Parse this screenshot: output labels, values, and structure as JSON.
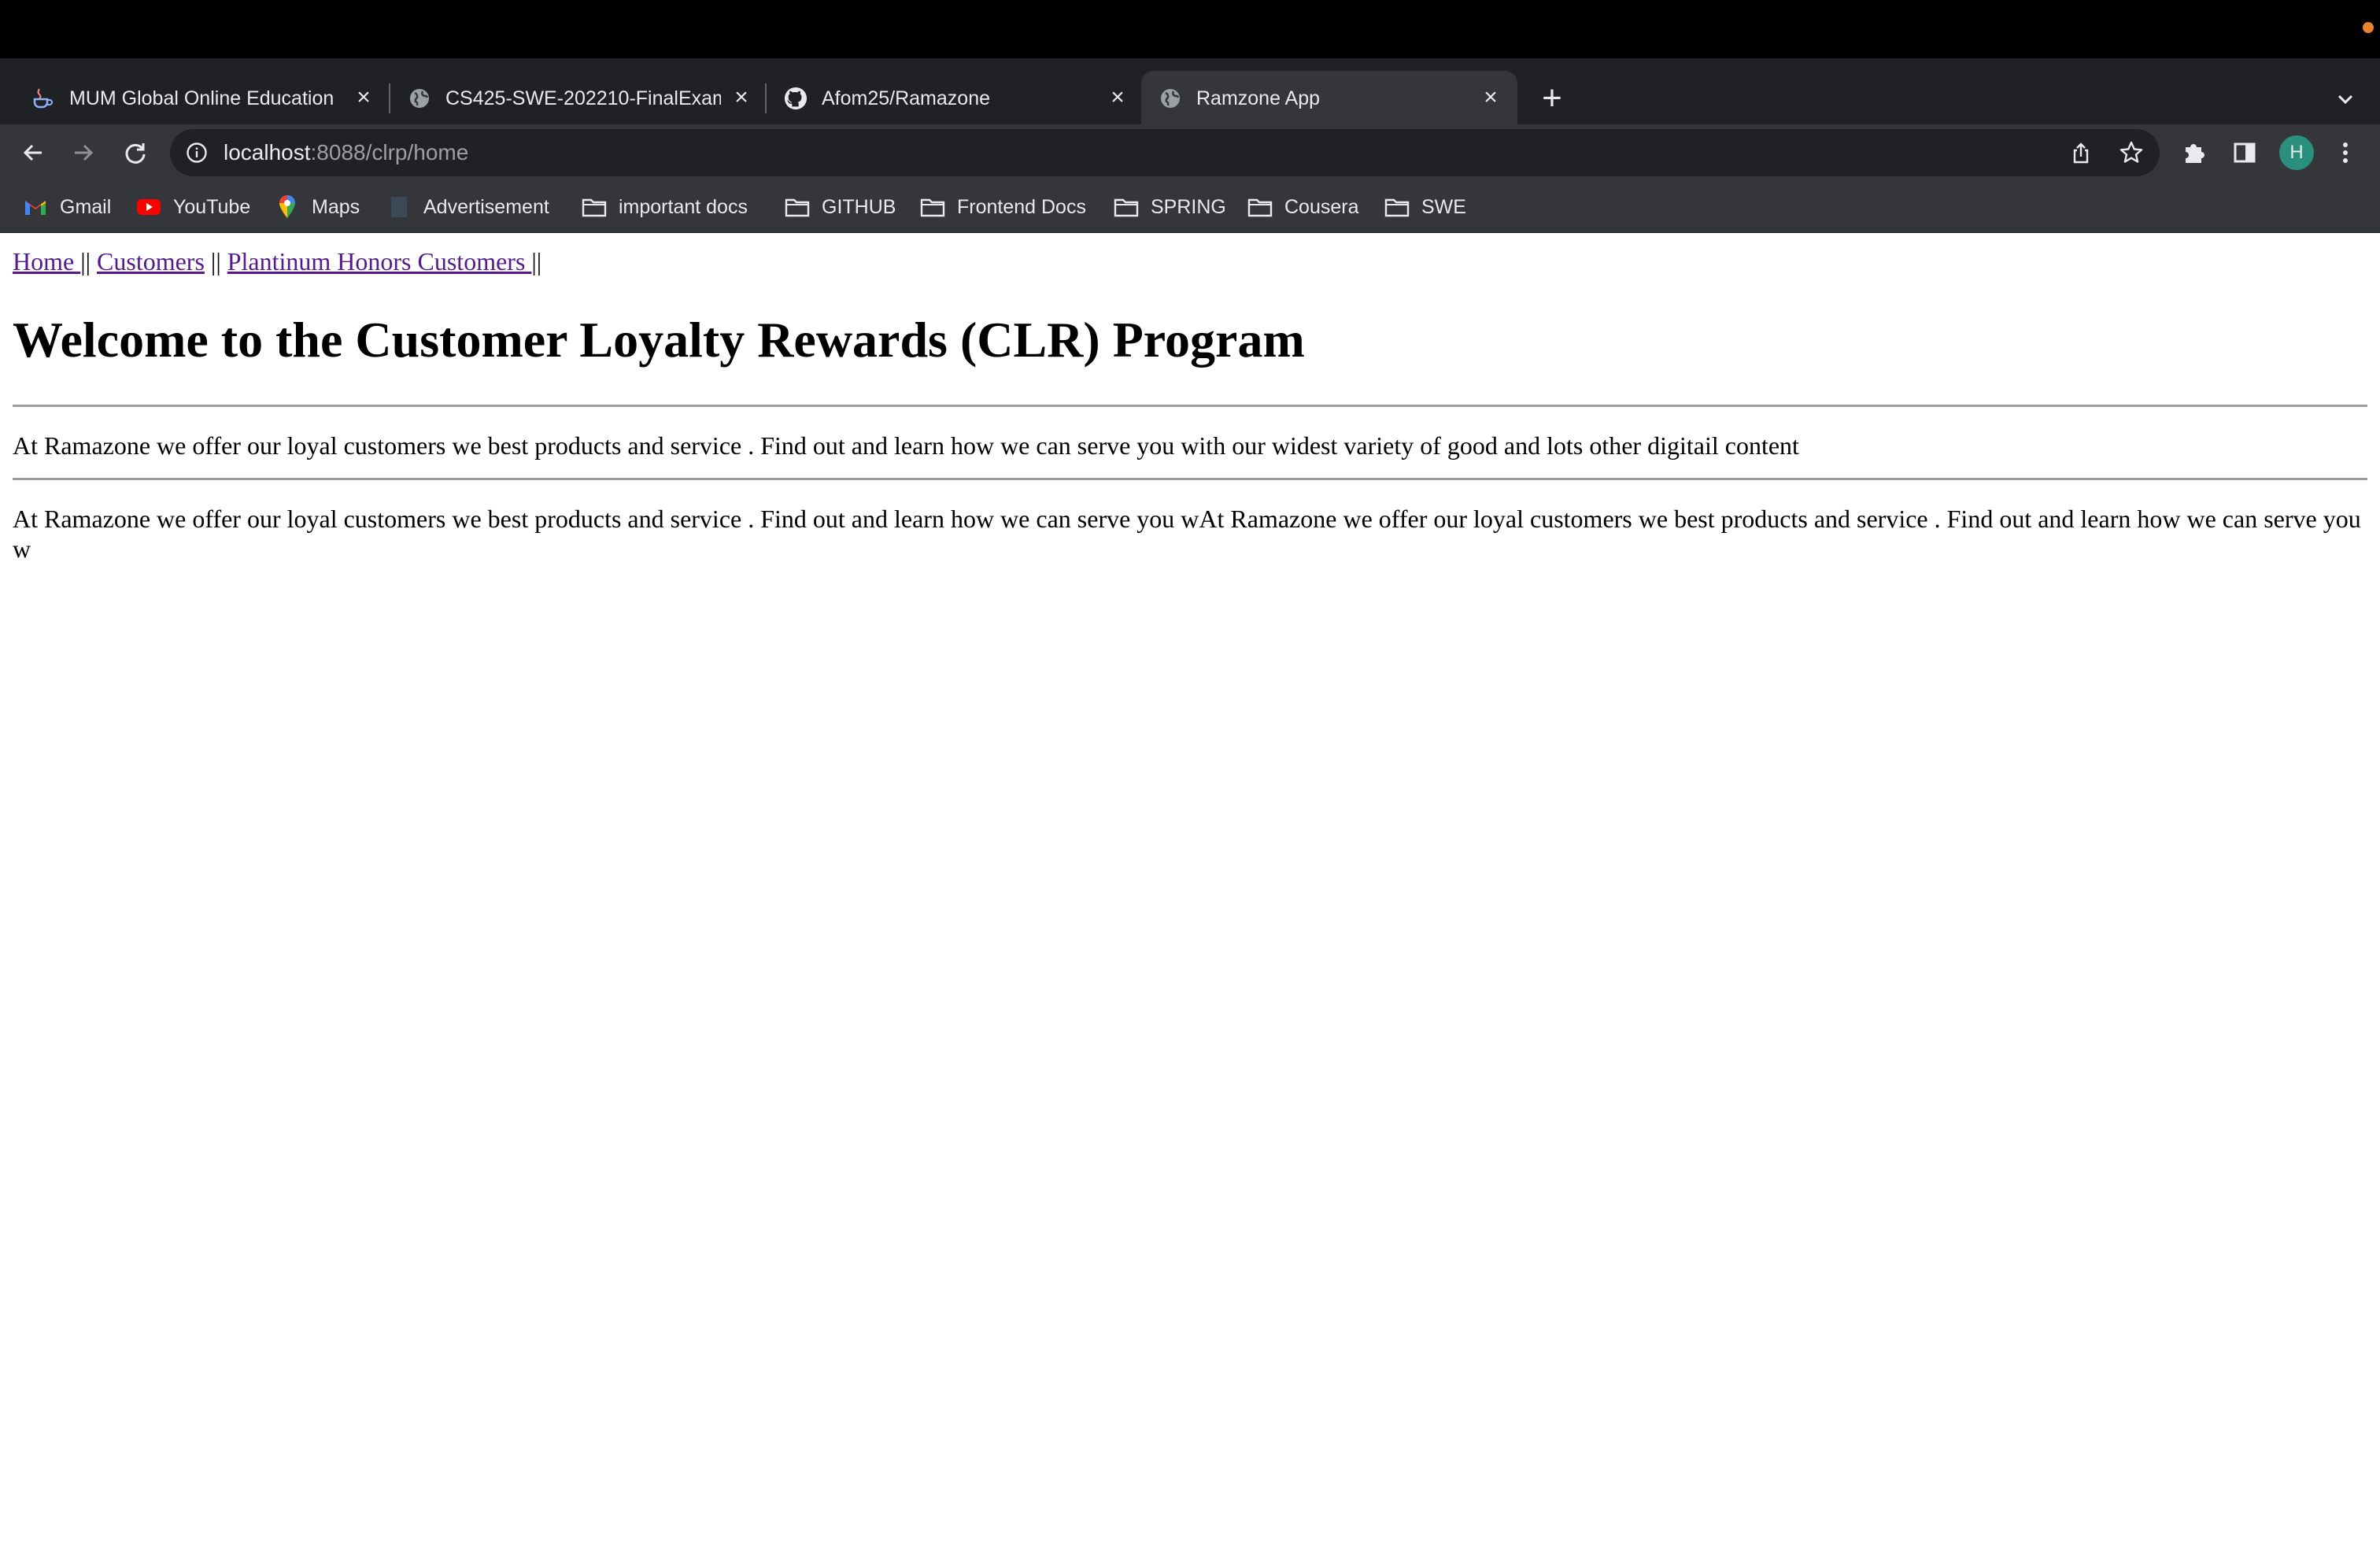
{
  "browser": {
    "tabs": [
      {
        "title": "MUM Global Online Education ·",
        "favicon": "java-cup-icon",
        "active": false
      },
      {
        "title": "CS425-SWE-202210-FinalExam",
        "favicon": "globe-icon",
        "active": false
      },
      {
        "title": "Afom25/Ramazone",
        "favicon": "github-icon",
        "active": false
      },
      {
        "title": "Ramzone App",
        "favicon": "globe-icon",
        "active": true
      }
    ],
    "address": {
      "host": "localhost",
      "path": ":8088/clrp/home"
    },
    "profile_initial": "H",
    "bookmarks": [
      {
        "label": "Gmail",
        "icon": "gmail-icon"
      },
      {
        "label": "YouTube",
        "icon": "youtube-icon"
      },
      {
        "label": "Maps",
        "icon": "maps-icon"
      },
      {
        "label": "Advertisement",
        "icon": "blank-page-icon"
      },
      {
        "label": "important docs",
        "icon": "folder-icon"
      },
      {
        "label": "GITHUB",
        "icon": "folder-icon"
      },
      {
        "label": "Frontend Docs",
        "icon": "folder-icon"
      },
      {
        "label": "SPRING",
        "icon": "folder-icon"
      },
      {
        "label": "Cousera",
        "icon": "folder-icon"
      },
      {
        "label": "SWE",
        "icon": "folder-icon"
      }
    ]
  },
  "page": {
    "nav": {
      "home": "Home ",
      "customers": "Customers",
      "platinum": "Plantinum Honors Customers ",
      "separator": "||"
    },
    "heading": "Welcome to the Customer Loyalty Rewards (CLR) Program",
    "paragraph1": "At Ramazone we offer our loyal customers we best products and service . Find out and learn how we can serve you with our widest variety of good and lots other digitail content",
    "paragraph2": "At Ramazone we offer our loyal customers we best products and service . Find out and learn how we can serve you wAt Ramazone we offer our loyal customers we best products and service . Find out and learn how we can serve you w"
  },
  "colors": {
    "link": "#551a8b",
    "chrome_dark": "#202124",
    "chrome_toolbar": "#35363a",
    "avatar": "#2a8f7c"
  }
}
